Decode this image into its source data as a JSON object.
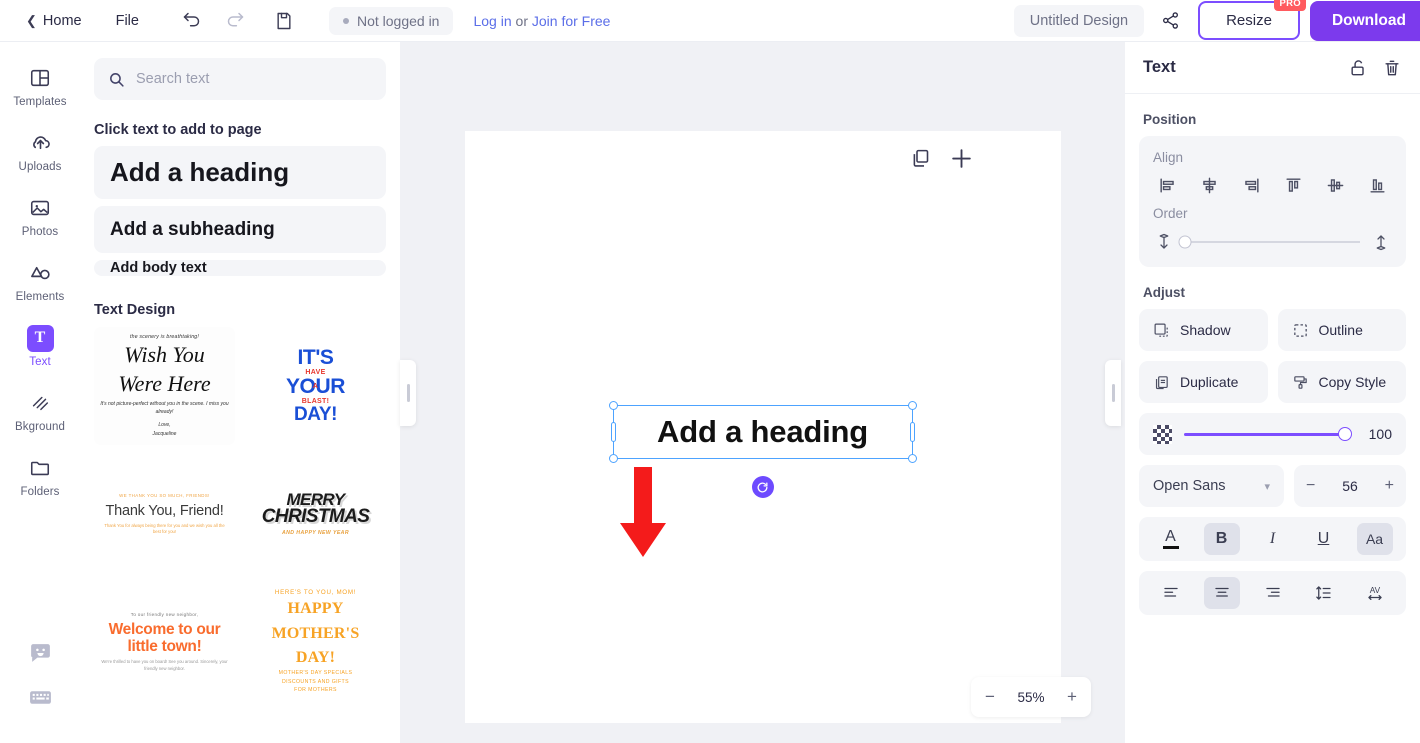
{
  "topbar": {
    "home": "Home",
    "file": "File",
    "undo_icon": "undo-icon",
    "redo_icon": "redo-icon",
    "save_icon": "save-icon",
    "status": "Not logged in",
    "login": "Log in",
    "or": "or",
    "join": "Join for Free",
    "design_name": "Untitled Design",
    "share_icon": "share-icon",
    "resize": "Resize",
    "pro": "PRO",
    "download": "Download"
  },
  "rail": {
    "items": [
      {
        "label": "Templates",
        "icon": "templates-icon",
        "active": false
      },
      {
        "label": "Uploads",
        "icon": "upload-cloud-icon",
        "active": false
      },
      {
        "label": "Photos",
        "icon": "photo-icon",
        "active": false
      },
      {
        "label": "Elements",
        "icon": "elements-icon",
        "active": false
      },
      {
        "label": "Text",
        "icon": "text-icon",
        "active": true
      },
      {
        "label": "Bkground",
        "icon": "background-icon",
        "active": false
      },
      {
        "label": "Folders",
        "icon": "folder-icon",
        "active": false
      }
    ],
    "bottom": [
      {
        "icon": "chat-smiley-icon"
      },
      {
        "icon": "keyboard-icon"
      }
    ]
  },
  "panel": {
    "search_placeholder": "Search text",
    "search_value": "",
    "search_icon": "search-icon",
    "add_label": "Click text to add to page",
    "presets": [
      {
        "label": "Add a heading"
      },
      {
        "label": "Add a subheading"
      },
      {
        "label": "Add body text"
      }
    ],
    "design_label": "Text Design",
    "designs": [
      {
        "name": "wish-you-were-here",
        "line1": "the scenery is breathtaking!",
        "line2a": "Wish You",
        "line2b": "Were Here",
        "line3": "It's not picture-perfect without you in the scene. I miss you already!",
        "line4a": "Love,",
        "line4b": "Jacqueline"
      },
      {
        "name": "its-your-day",
        "w1": "IT'S",
        "w2": "YOUR",
        "w3": "DAY!",
        "r1": "HAVE",
        "r2": "A",
        "r3": "BLAST!"
      },
      {
        "name": "thank-you-friend",
        "top": "WE THANK YOU SO MUCH, FRIENDS!",
        "big": "Thank You, Friend!",
        "bottom": "Thank You for always being there for you and we wish you all the best for you!"
      },
      {
        "name": "merry-christmas",
        "w1": "MERRY",
        "w2": "CHRISTMAS",
        "sub": "AND HAPPY NEW YEAR"
      },
      {
        "name": "welcome-little-town",
        "top": "To our friendly new neighbor,",
        "big1": "Welcome to our",
        "big2": "little town!",
        "bottom": "We're thrilled to have you on board! See you around. Sincerely, your friendly new neighbor."
      },
      {
        "name": "happy-mothers-day",
        "top": "HERE'S TO YOU, MOM!",
        "big1": "HAPPY",
        "big2": "MOTHER'S",
        "big3": "DAY!",
        "b1": "MOTHER'S DAY SPECIALS",
        "b2": "DISCOUNTS AND GIFTS",
        "b3": "FOR MOTHERS"
      }
    ]
  },
  "canvas": {
    "duplicate_page_icon": "duplicate-page-icon",
    "add_page_icon": "add-page-icon",
    "selected_text": "Add a heading",
    "rotate_icon": "rotate-handle-icon",
    "annotation_icon": "red-down-arrow",
    "zoom_out": "−",
    "zoom_value": "55%",
    "zoom_in": "+"
  },
  "rpanel": {
    "title": "Text",
    "lock_icon": "unlock-icon",
    "delete_icon": "trash-icon",
    "position_label": "Position",
    "align_label": "Align",
    "align_icons": [
      "align-left-icon",
      "align-center-horizontal-icon",
      "align-right-icon",
      "align-top-icon",
      "align-middle-vertical-icon",
      "align-bottom-icon"
    ],
    "order_label": "Order",
    "order_back_icon": "send-backward-icon",
    "order_front_icon": "bring-forward-icon",
    "order_value": 0,
    "adjust_label": "Adjust",
    "buttons": [
      {
        "label": "Shadow",
        "icon": "shadow-icon"
      },
      {
        "label": "Outline",
        "icon": "outline-icon"
      },
      {
        "label": "Duplicate",
        "icon": "duplicate-icon"
      },
      {
        "label": "Copy Style",
        "icon": "copy-style-icon"
      }
    ],
    "opacity_icon": "transparency-checker-icon",
    "opacity_value": "100",
    "font_family": "Open Sans",
    "font_chevron": "chevron-down-icon",
    "font_minus": "−",
    "font_size": "56",
    "font_plus": "+",
    "format_row": [
      {
        "name": "text-color",
        "label": "A",
        "active": false
      },
      {
        "name": "bold",
        "label": "B",
        "active": true
      },
      {
        "name": "italic",
        "label": "I",
        "active": false
      },
      {
        "name": "underline",
        "label": "U",
        "active": false
      },
      {
        "name": "letter-case",
        "label": "Aa",
        "active": true
      }
    ],
    "align_row": [
      {
        "name": "align-text-left-icon",
        "active": false
      },
      {
        "name": "align-text-center-icon",
        "active": true
      },
      {
        "name": "align-text-right-icon",
        "active": false
      },
      {
        "name": "line-height-icon",
        "active": false
      },
      {
        "name": "letter-spacing-icon",
        "active": false
      }
    ]
  },
  "colors": {
    "accent": "#7c4dff",
    "download": "#7c3aed",
    "link": "#5b6ee8",
    "selection": "#4da3ff",
    "annotation": "#f41b1b",
    "pro_badge": "#ff5a5f"
  }
}
